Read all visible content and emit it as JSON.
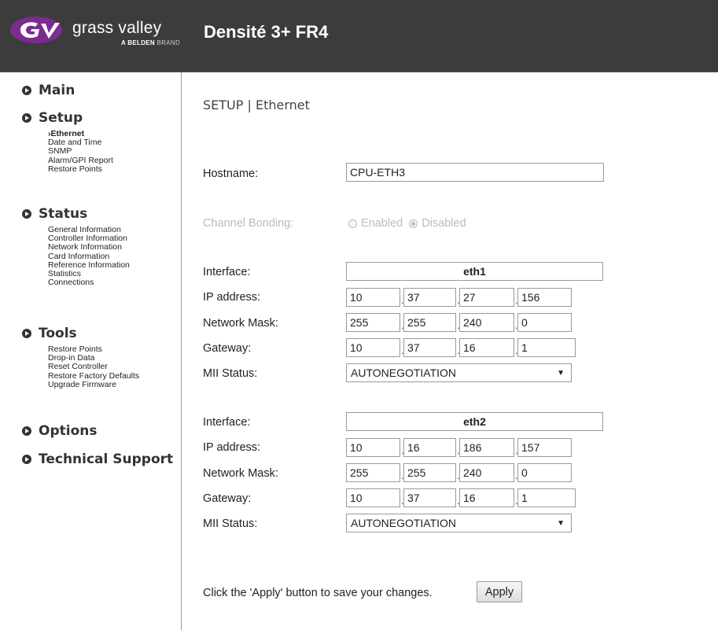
{
  "header": {
    "logo_text": "grass valley",
    "logo_sub_bold": "A BELDEN",
    "logo_sub_rest": " BRAND",
    "product_title": "Densité 3+ FR4"
  },
  "sidebar": {
    "main": "Main",
    "setup": {
      "label": "Setup",
      "items": [
        "›Ethernet",
        "Date and Time",
        "SNMP",
        "Alarm/GPI Report",
        "Restore Points"
      ]
    },
    "status": {
      "label": "Status",
      "items": [
        "General Information",
        "Controller Information",
        "Network Information",
        "Card Information",
        "Reference Information",
        "Statistics",
        "Connections"
      ]
    },
    "tools": {
      "label": "Tools",
      "items": [
        "Restore Points",
        "Drop-in Data",
        "Reset Controller",
        "Restore Factory Defaults",
        "Upgrade Firmware"
      ]
    },
    "options": "Options",
    "technical_support": "Technical Support"
  },
  "main": {
    "heading": "SETUP | Ethernet",
    "hostname_label": "Hostname:",
    "hostname_value": "CPU-ETH3",
    "bonding_label": "Channel Bonding:",
    "bonding_enabled": "Enabled",
    "bonding_disabled": "Disabled",
    "interfaces": [
      {
        "interface_label": "Interface:",
        "interface_name": "eth1",
        "ip_label": "IP address:",
        "ip": [
          "10",
          "37",
          "27",
          "156"
        ],
        "mask_label": "Network Mask:",
        "mask": [
          "255",
          "255",
          "240",
          "0"
        ],
        "gateway_label": "Gateway:",
        "gateway": [
          "10",
          "37",
          "16",
          "1"
        ],
        "mii_label": "MII Status:",
        "mii_value": "AUTONEGOTIATION"
      },
      {
        "interface_label": "Interface:",
        "interface_name": "eth2",
        "ip_label": "IP address:",
        "ip": [
          "10",
          "16",
          "186",
          "157"
        ],
        "mask_label": "Network Mask:",
        "mask": [
          "255",
          "255",
          "240",
          "0"
        ],
        "gateway_label": "Gateway:",
        "gateway": [
          "10",
          "37",
          "16",
          "1"
        ],
        "mii_label": "MII Status:",
        "mii_value": "AUTONEGOTIATION"
      }
    ],
    "apply_text": "Click the 'Apply' button to save your changes.",
    "apply_button": "Apply"
  },
  "colors": {
    "header_bg": "#3c3c3c",
    "logo_purple": "#7b2d8e"
  }
}
